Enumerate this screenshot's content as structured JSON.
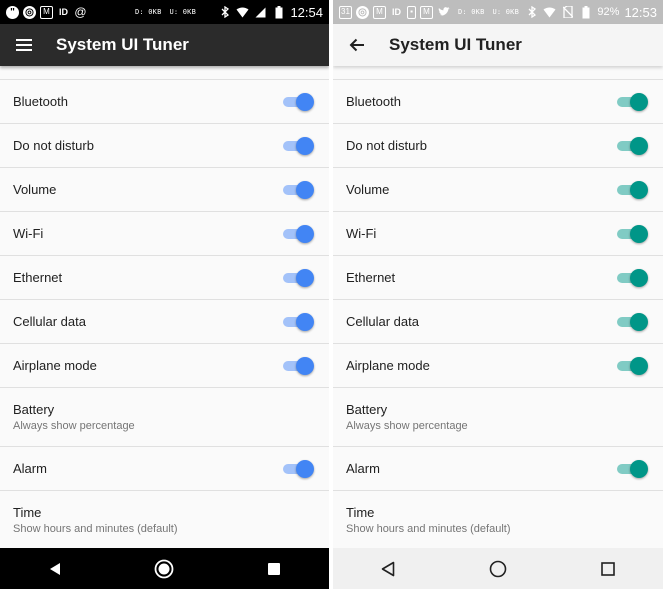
{
  "colors": {
    "left_accent": "#4285f4",
    "left_track": "#a3c2f9",
    "right_accent": "#009688",
    "right_track": "#80cbc4"
  },
  "left": {
    "status": {
      "icons": [
        "hangouts-icon",
        "chrome-icon",
        "gmail-icon",
        "id-icon",
        "at-icon"
      ],
      "net_down": "D: 0KB",
      "net_up": "U: 0KB",
      "time": "12:54"
    },
    "appbar": {
      "nav_icon": "menu-icon",
      "title": "System UI Tuner"
    },
    "items": [
      {
        "label": "Bluetooth",
        "on": true
      },
      {
        "label": "Do not disturb",
        "on": true
      },
      {
        "label": "Volume",
        "on": true
      },
      {
        "label": "Wi-Fi",
        "on": true
      },
      {
        "label": "Ethernet",
        "on": true
      },
      {
        "label": "Cellular data",
        "on": true
      },
      {
        "label": "Airplane mode",
        "on": true
      },
      {
        "label": "Battery",
        "sub": "Always show percentage"
      },
      {
        "label": "Alarm",
        "on": true
      },
      {
        "label": "Time",
        "sub": "Show hours and minutes (default)"
      }
    ]
  },
  "right": {
    "status": {
      "icons": [
        "calendar-icon",
        "chrome-icon",
        "gmail-icon",
        "id-icon",
        "phone-icon",
        "gmail-icon",
        "twitter-icon"
      ],
      "net_down": "D: 0KB",
      "net_up": "U: 0KB",
      "battery": "92%",
      "time": "12:53"
    },
    "appbar": {
      "nav_icon": "back-arrow-icon",
      "title": "System UI Tuner"
    },
    "items": [
      {
        "label": "Bluetooth",
        "on": true
      },
      {
        "label": "Do not disturb",
        "on": true
      },
      {
        "label": "Volume",
        "on": true
      },
      {
        "label": "Wi-Fi",
        "on": true
      },
      {
        "label": "Ethernet",
        "on": true
      },
      {
        "label": "Cellular data",
        "on": true
      },
      {
        "label": "Airplane mode",
        "on": true
      },
      {
        "label": "Battery",
        "sub": "Always show percentage"
      },
      {
        "label": "Alarm",
        "on": true
      },
      {
        "label": "Time",
        "sub": "Show hours and minutes (default)"
      }
    ]
  }
}
